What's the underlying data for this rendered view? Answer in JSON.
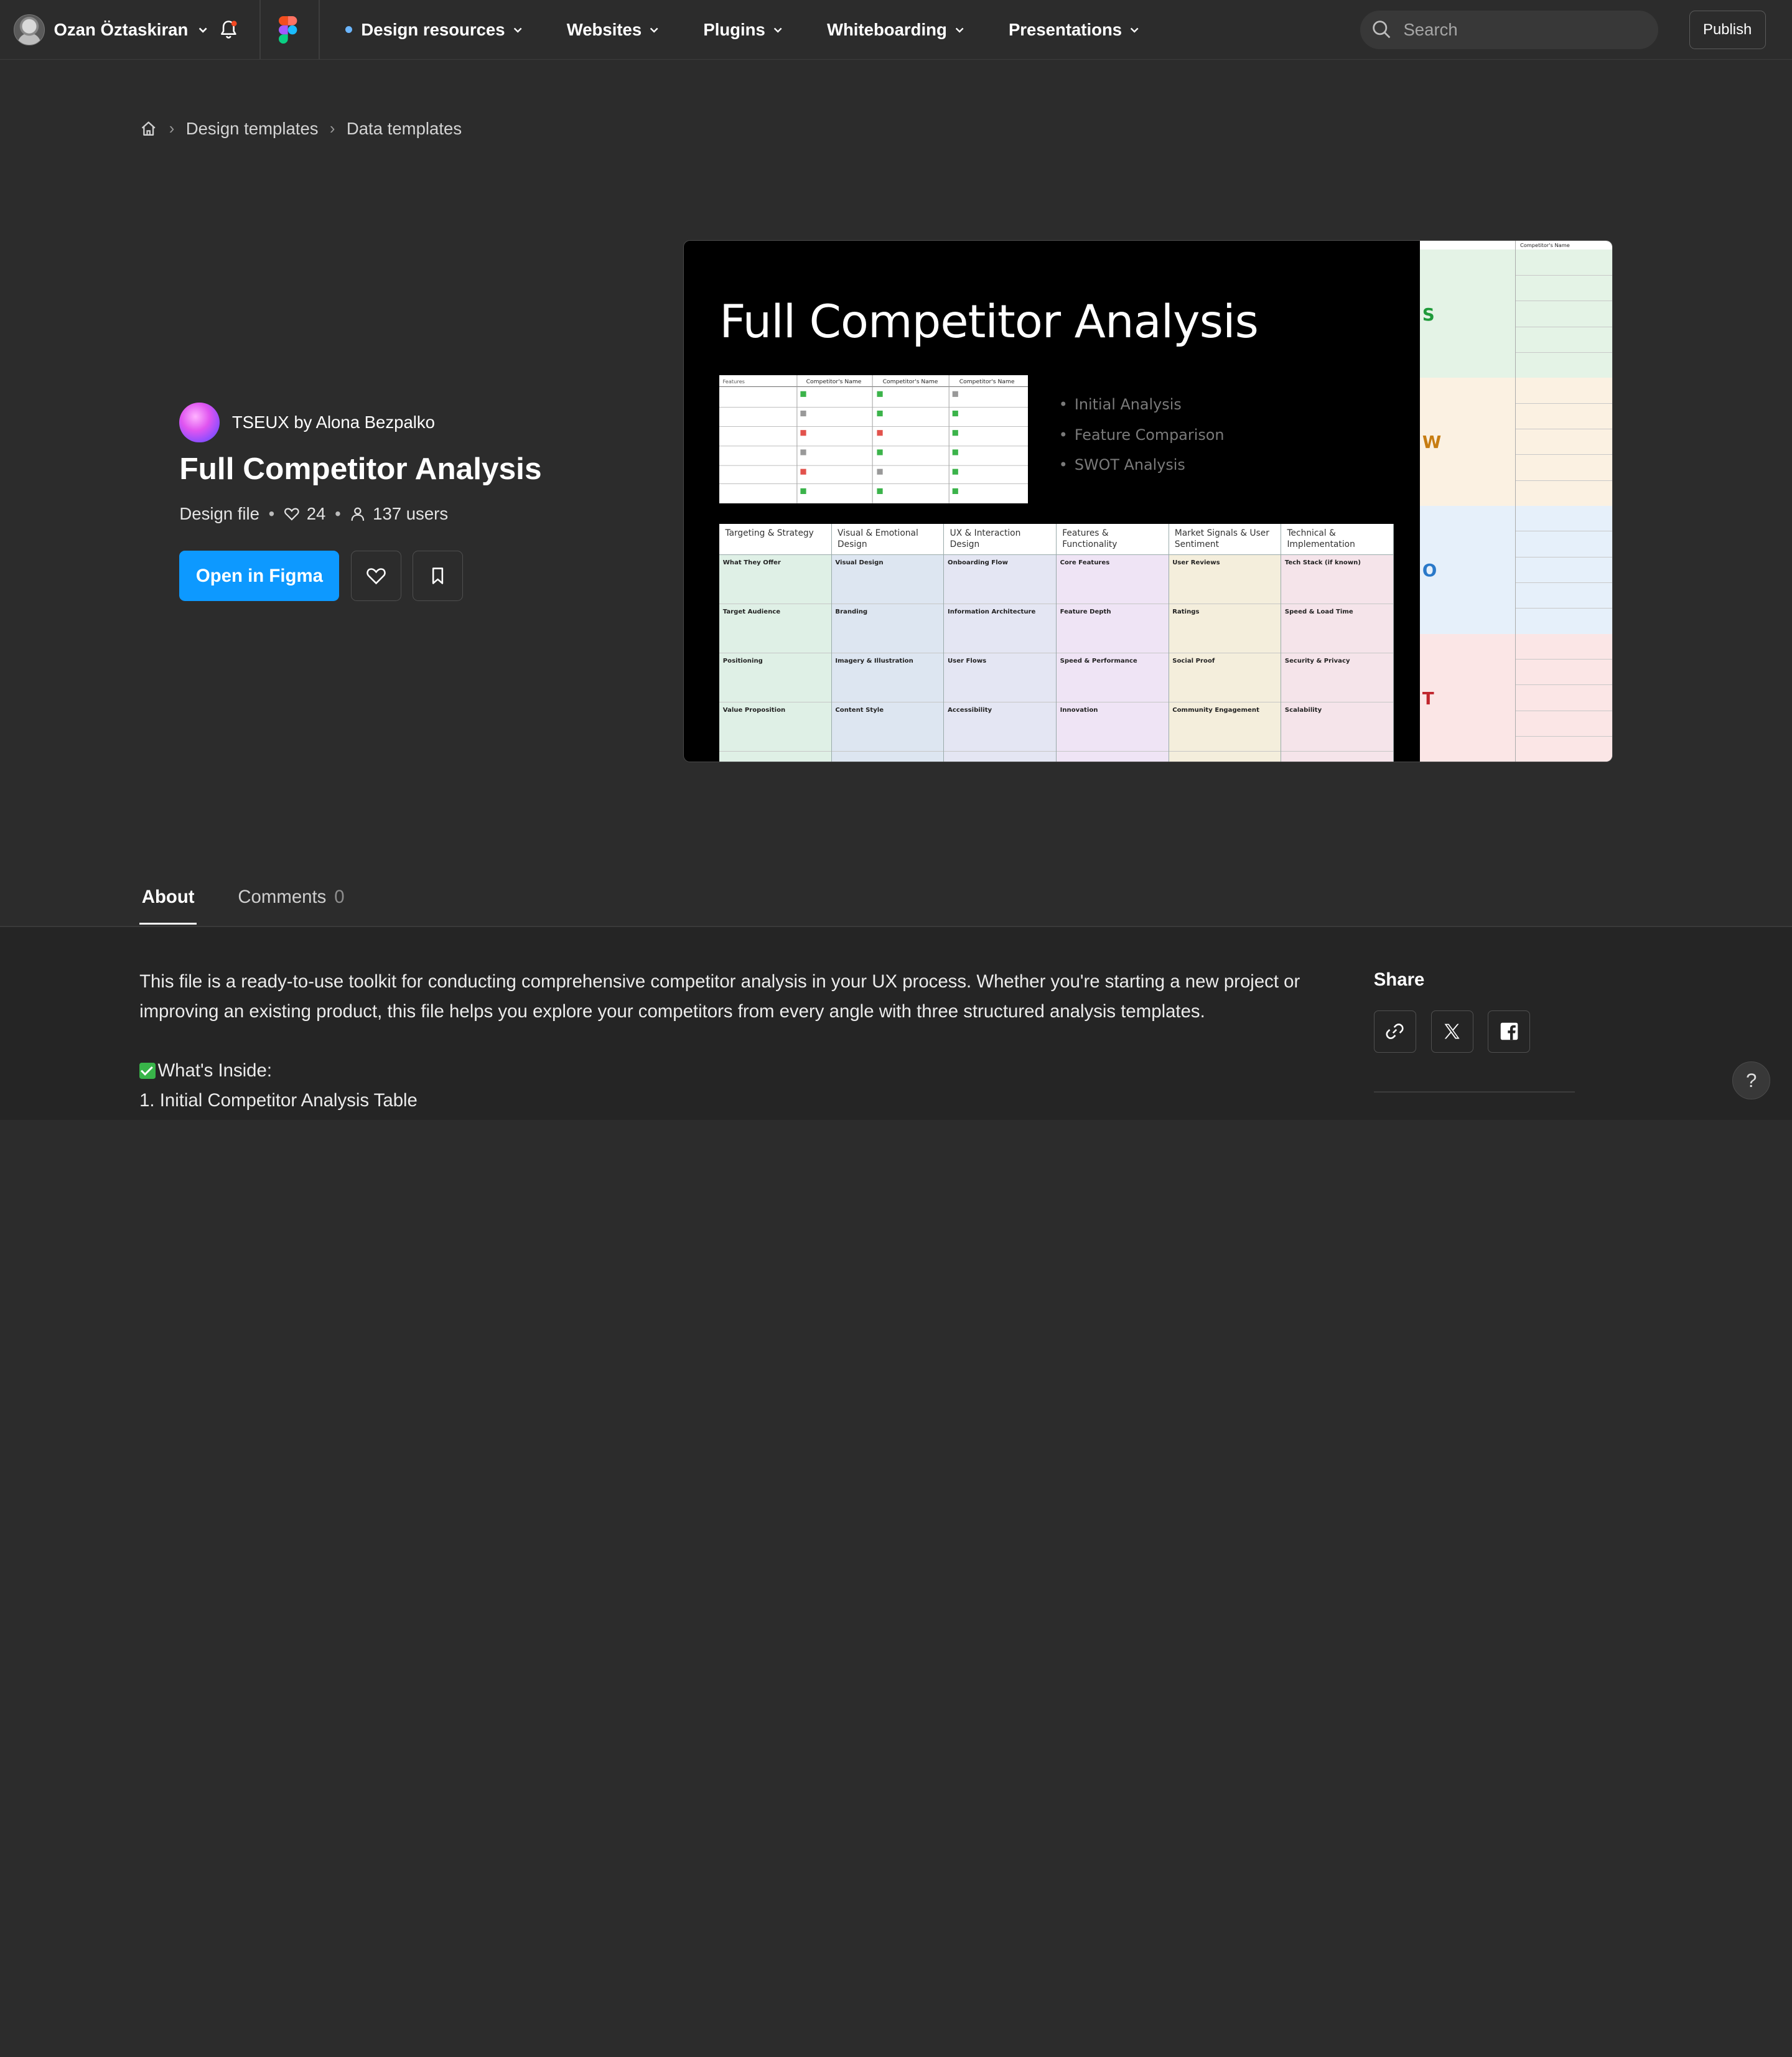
{
  "topbar": {
    "user_name": "Ozan Öztaskiran",
    "nav": [
      {
        "label": "Design resources",
        "active": true
      },
      {
        "label": "Websites"
      },
      {
        "label": "Plugins"
      },
      {
        "label": "Whiteboarding"
      },
      {
        "label": "Presentations"
      }
    ],
    "search_placeholder": "Search",
    "publish_label": "Publish"
  },
  "breadcrumb": {
    "items": [
      "Design templates",
      "Data templates"
    ]
  },
  "file": {
    "creator": "TSEUX by Alona Bezpalko",
    "title": "Full Competitor Analysis",
    "type": "Design file",
    "likes": "24",
    "users": "137 users",
    "open_label": "Open in Figma"
  },
  "preview": {
    "title": "Full Competitor Analysis",
    "bullets": [
      "Initial Analysis",
      "Feature Comparison",
      "SWOT Analysis"
    ],
    "table_headers": [
      "Features",
      "Competitor's Name",
      "Competitor's Name",
      "Competitor's Name"
    ],
    "grid_headers": [
      "Targeting & Strategy",
      "Visual & Emotional Design",
      "UX & Interaction Design",
      "Features & Functionality",
      "Market Signals & User Sentiment",
      "Technical & Implementation"
    ],
    "grid_colors": [
      "#dff0e6",
      "#dde6f1",
      "#e4e6f3",
      "#efe4f5",
      "#f4eedc",
      "#f5e4ea"
    ],
    "grid_rows": [
      [
        "What They Offer",
        "Visual Design",
        "Onboarding Flow",
        "Core Features",
        "User Reviews",
        "Tech Stack (if known)"
      ],
      [
        "Target Audience",
        "Branding",
        "Information Architecture",
        "Feature Depth",
        "Ratings",
        "Speed & Load Time"
      ],
      [
        "Positioning",
        "Imagery & Illustration",
        "User Flows",
        "Speed & Performance",
        "Social Proof",
        "Security & Privacy"
      ],
      [
        "Value Proposition",
        "Content Style",
        "Accessibility",
        "Innovation",
        "Community Engagement",
        "Scalability"
      ]
    ],
    "swot_header": "Competitor's Name",
    "swot": [
      {
        "letter": "S",
        "color": "#1f9a3a",
        "bg": "#e4f3e6"
      },
      {
        "letter": "W",
        "color": "#c77d12",
        "bg": "#fbf1e2"
      },
      {
        "letter": "O",
        "color": "#2a79c9",
        "bg": "#e6f0fa"
      },
      {
        "letter": "T",
        "color": "#c0262d",
        "bg": "#fbe6e6"
      }
    ]
  },
  "tabs": [
    {
      "label": "About",
      "count": ""
    },
    {
      "label": "Comments",
      "count": "0"
    }
  ],
  "about": {
    "description": "This file is a ready-to-use toolkit for conducting comprehensive competitor analysis in your UX process. Whether you're starting a new project or improving an existing product, this file helps you explore your competitors from every angle with three structured analysis templates.",
    "inside_heading": "What's Inside:",
    "inside_items": [
      "1. Initial Competitor Analysis Table"
    ]
  },
  "share": {
    "heading": "Share"
  },
  "help_label": "?",
  "colors": {
    "accent": "#0d99ff",
    "background": "#2c2c2c"
  }
}
